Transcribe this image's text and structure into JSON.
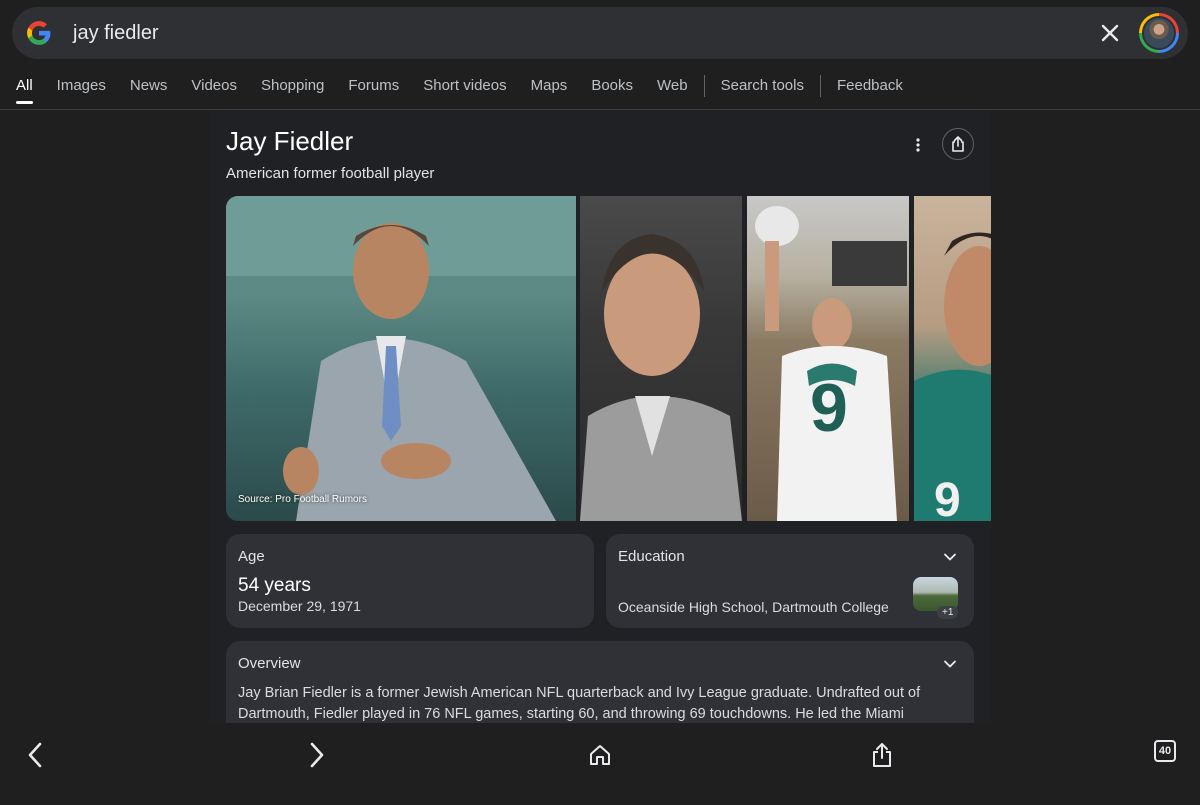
{
  "search": {
    "query": "jay fiedler",
    "icons": {
      "logo": "google-g-icon",
      "clear": "close-icon",
      "avatar": "account-avatar"
    }
  },
  "tabs": [
    {
      "label": "All",
      "active": true
    },
    {
      "label": "Images"
    },
    {
      "label": "News"
    },
    {
      "label": "Videos"
    },
    {
      "label": "Shopping"
    },
    {
      "label": "Forums"
    },
    {
      "label": "Short videos"
    },
    {
      "label": "Maps"
    },
    {
      "label": "Books"
    },
    {
      "label": "Web"
    }
  ],
  "tools": {
    "search_tools": "Search tools",
    "feedback": "Feedback"
  },
  "knowledge_panel": {
    "title": "Jay Fiedler",
    "subtitle": "American former football player",
    "image_source": "Source: Pro Football Rumors",
    "age": {
      "label": "Age",
      "value": "54 years",
      "date": "December 29, 1971"
    },
    "education": {
      "label": "Education",
      "value": "Oceanside High School, Dartmouth College",
      "more_count": "+1"
    },
    "overview": {
      "label": "Overview",
      "text": "Jay Brian Fiedler is a former Jewish American NFL quarterback and Ivy League graduate. Undrafted out of Dartmouth, Fiedler played in 76 NFL games, starting 60, and throwing 69 touchdowns. He led the Miami"
    }
  },
  "bottom_nav": {
    "tab_count": "40"
  },
  "colors": {
    "background": "#1f1f1f",
    "searchbox": "#2f3034",
    "card": "#2f3137",
    "panel": "#202124"
  }
}
